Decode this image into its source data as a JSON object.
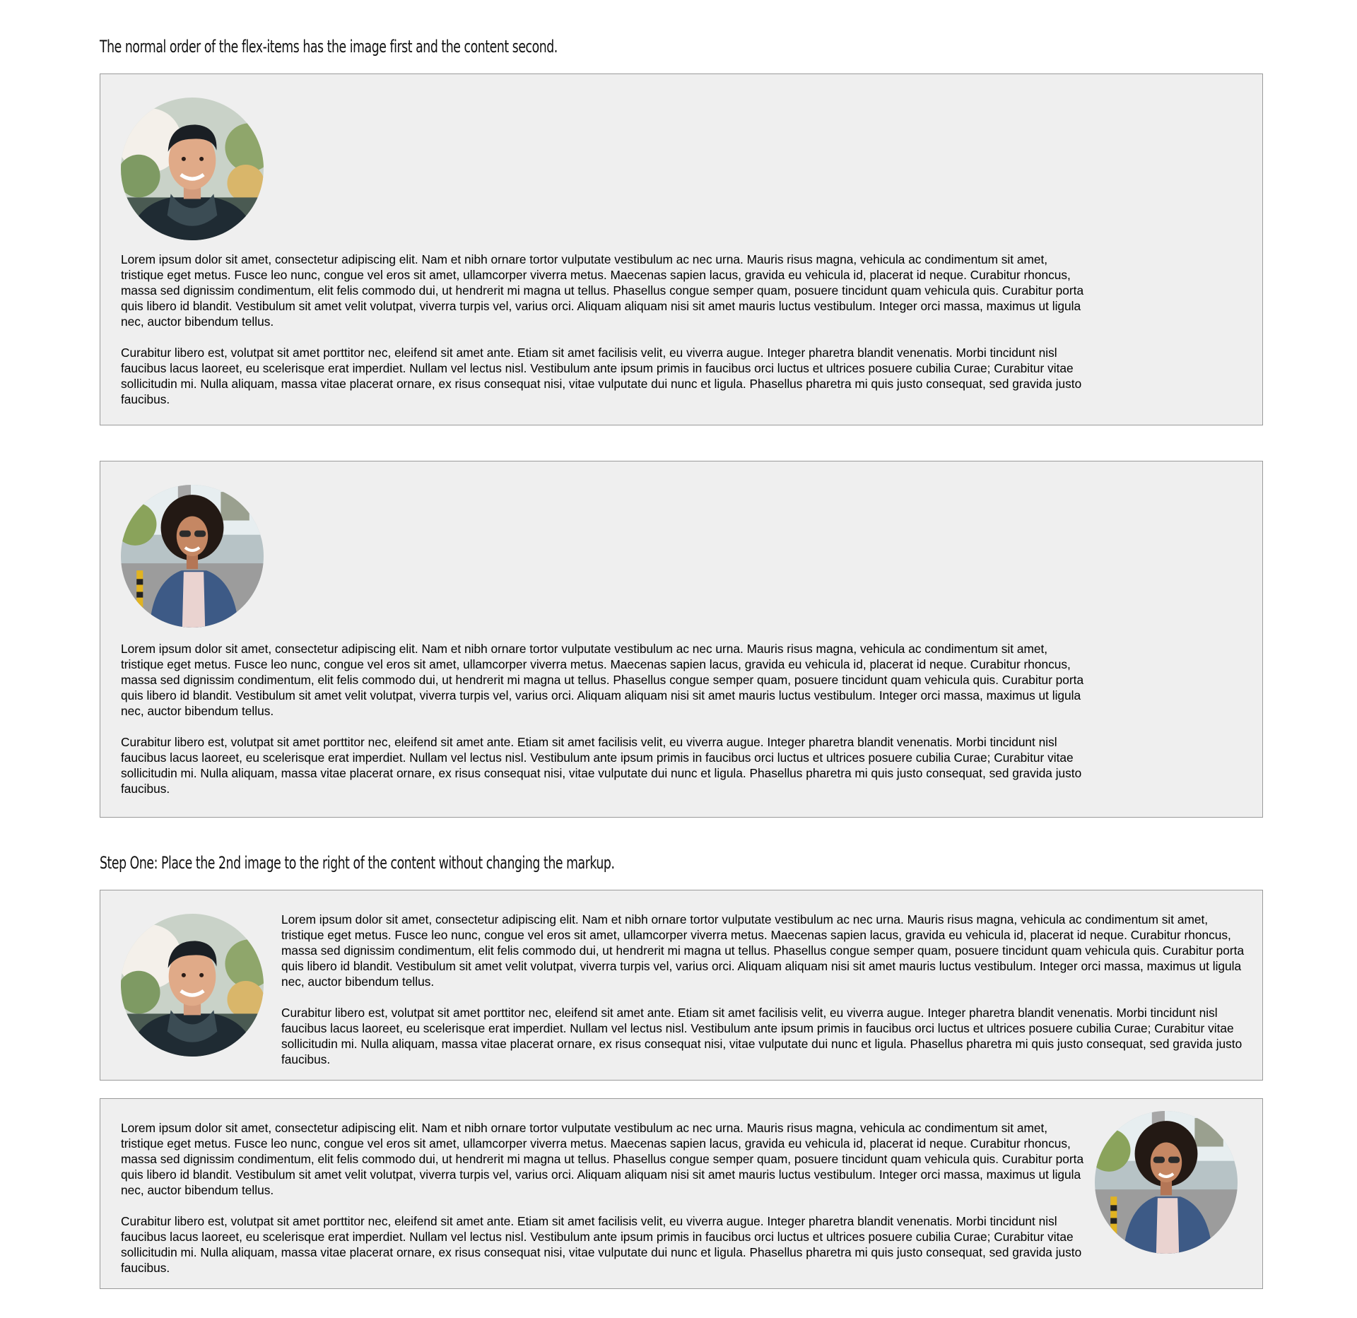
{
  "headings": {
    "normal": "The normal order of the flex-items has the image first and the content second.",
    "step_one": "Step One: Place the 2nd image to the right of the content without changing the markup."
  },
  "content": {
    "para1": "Lorem ipsum dolor sit amet, consectetur adipiscing elit. Nam et nibh ornare tortor vulputate vestibulum ac nec urna. Mauris risus magna, vehicula ac condimentum sit amet, tristique eget metus. Fusce leo nunc, congue vel eros sit amet, ullamcorper viverra metus. Maecenas sapien lacus, gravida eu vehicula id, placerat id neque. Curabitur rhoncus, massa sed dignissim condimentum, elit felis commodo dui, ut hendrerit mi magna ut tellus. Phasellus congue semper quam, posuere tincidunt quam vehicula quis. Curabitur porta quis libero id blandit. Vestibulum sit amet velit volutpat, viverra turpis vel, varius orci. Aliquam aliquam nisi sit amet mauris luctus vestibulum. Integer orci massa, maximus ut ligula nec, auctor bibendum tellus.",
    "para2": "Curabitur libero est, volutpat sit amet porttitor nec, eleifend sit amet ante. Etiam sit amet facilisis velit, eu viverra augue. Integer pharetra blandit venenatis. Morbi tincidunt nisl faucibus lacus laoreet, eu scelerisque erat imperdiet. Nullam vel lectus nisl. Vestibulum ante ipsum primis in faucibus orci luctus et ultrices posuere cubilia Curae; Curabitur vitae sollicitudin mi. Nulla aliquam, massa vitae placerat ornare, ex risus consequat nisi, vitae vulputate dui nunc et ligula. Phasellus pharetra mi quis justo consequat, sed gravida justo faucibus."
  },
  "colors": {
    "card_background": "#efefef",
    "card_border": "#9a9a9a",
    "text": "#000000"
  },
  "images": {
    "man": "man-portrait",
    "woman": "woman-portrait"
  }
}
